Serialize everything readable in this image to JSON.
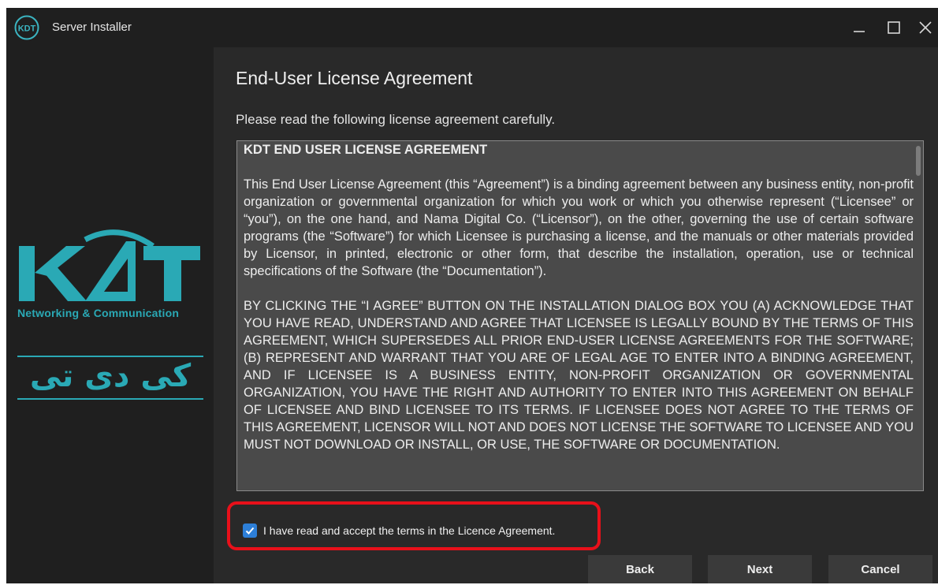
{
  "window": {
    "title": "Server Installer",
    "logo_text": "KDT"
  },
  "sidebar": {
    "brand_name": "KDT",
    "brand_tagline": "Networking & Communication",
    "brand_persian": "کی دی تی",
    "brand_color": "#2aa9b5"
  },
  "page": {
    "heading": "End-User License Agreement",
    "intro": "Please read the following license agreement carefully."
  },
  "license": {
    "title": "KDT END USER LICENSE AGREEMENT",
    "paragraphs": [
      "This End User License Agreement (this “Agreement”) is a binding agreement between any business entity, non-profit organization or governmental organization for which you work or which you otherwise represent (“Licensee” or “you”), on the one hand, and Nama Digital Co. (“Licensor”), on the other, governing the use of certain software programs (the “Software”) for which Licensee is purchasing a license, and the manuals or other materials provided by Licensor, in printed, electronic or other form, that describe the installation, operation, use or technical specifications of the Software (the “Documentation”).",
      "BY CLICKING THE “I AGREE” BUTTON ON THE INSTALLATION DIALOG BOX YOU (A) ACKNOWLEDGE THAT YOU HAVE READ, UNDERSTAND AND AGREE THAT LICENSEE IS LEGALLY BOUND BY THE TERMS OF THIS AGREEMENT, WHICH SUPERSEDES ALL PRIOR END-USER LICENSE AGREEMENTS FOR THE SOFTWARE; (B) REPRESENT AND WARRANT THAT YOU ARE OF LEGAL AGE TO ENTER INTO A BINDING AGREEMENT, AND IF LICENSEE IS A BUSINESS ENTITY, NON-PROFIT ORGANIZATION OR GOVERNMENTAL ORGANIZATION, YOU HAVE THE RIGHT AND AUTHORITY TO ENTER INTO THIS AGREEMENT ON BEHALF OF LICENSEE AND BIND LICENSEE TO ITS TERMS. IF LICENSEE DOES NOT AGREE TO THE TERMS OF THIS AGREEMENT, LICENSOR WILL NOT AND DOES NOT LICENSE THE SOFTWARE TO LICENSEE AND YOU MUST NOT DOWNLOAD OR INSTALL, OR USE, THE SOFTWARE OR DOCUMENTATION."
    ]
  },
  "accept": {
    "label": "I have read and accept the terms in the Licence Agreement.",
    "checked": true,
    "highlight_color": "#e8101a",
    "checkbox_color": "#2d7fd8"
  },
  "buttons": {
    "back": "Back",
    "next": "Next",
    "cancel": "Cancel"
  },
  "icons": {
    "minimize": "minimize-icon",
    "maximize": "maximize-icon",
    "close": "close-icon",
    "check": "checkmark-icon"
  }
}
